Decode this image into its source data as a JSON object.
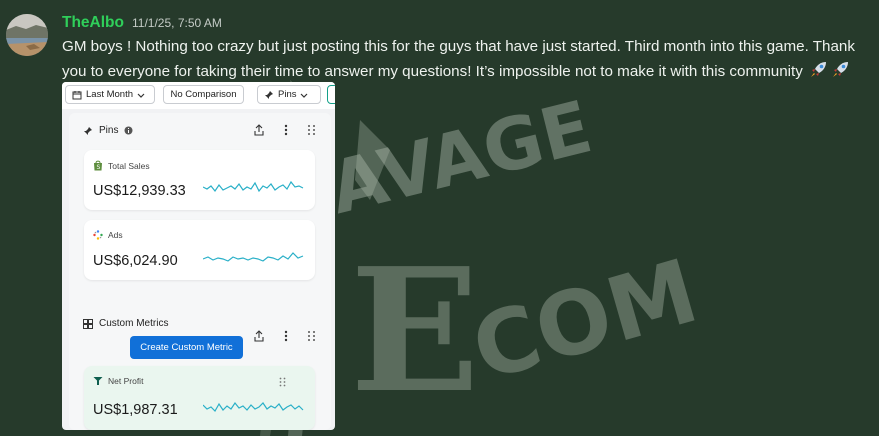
{
  "message": {
    "author": "TheAlbo",
    "timestamp": "11/1/25, 7:50 AM",
    "text": "GM boys ! Nothing too crazy but just posting this for the guys that have just started. Third month into this game. Thank you to everyone for taking their time to answer my questions! It’s impossible not to make it with this community",
    "emojis": [
      "rocket-icon",
      "rocket-icon"
    ]
  },
  "attachment": {
    "toolbar": {
      "date_range": "Last Month",
      "comparison": "No Comparison",
      "pins": "Pins"
    },
    "pins_section": {
      "title": "Pins"
    },
    "cards": [
      {
        "label": "Total Sales",
        "value": "US$12,939.33",
        "icon": "shopify-bag-icon"
      },
      {
        "label": "Ads",
        "value": "US$6,024.90",
        "icon": "ads-dots-icon"
      }
    ],
    "custom_metrics": {
      "title": "Custom Metrics",
      "create_button": "Create Custom Metric",
      "card": {
        "label": "Net Profit",
        "value": "US$1,987.31",
        "icon": "net-profit-icon"
      }
    },
    "colors": {
      "sparkline": "#2ab0c8",
      "accent_button": "#1170d8"
    }
  },
  "watermark": {
    "text_line1": "SAVAGE",
    "text_line2": "ECOM"
  },
  "colors": {
    "background": "#263a2b",
    "author": "#2fcf5a"
  }
}
